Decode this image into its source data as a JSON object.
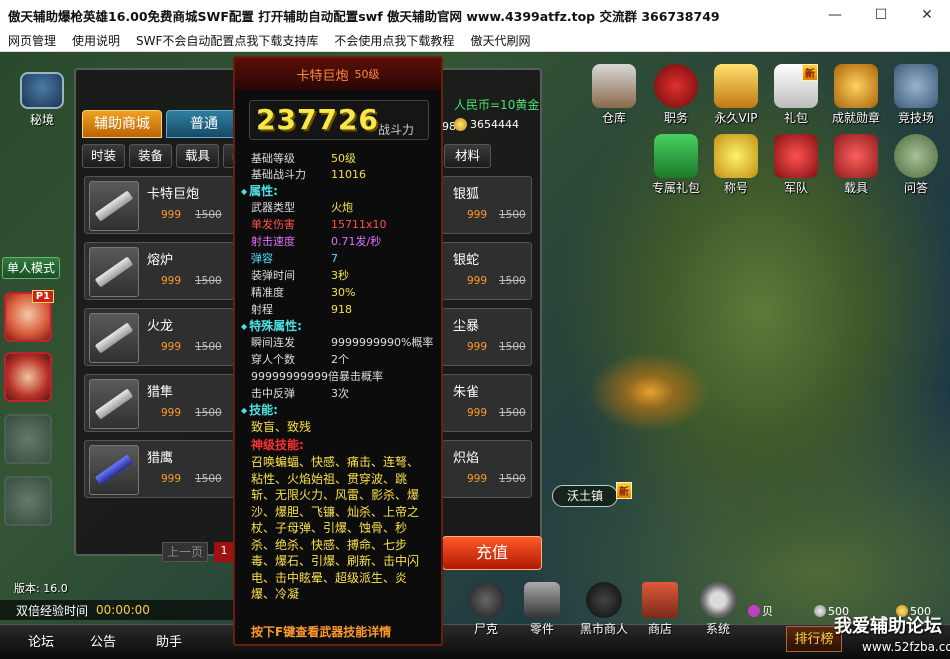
{
  "window": {
    "title": "傲天辅助爆枪英雄16.00免费商城SWF配置  打开辅助自动配置swf 傲天辅助官网 www.4399atfz.top 交流群 366738749",
    "minimize": "—",
    "maximize": "☐",
    "close": "✕"
  },
  "menu": [
    "网页管理",
    "使用说明",
    "SWF不会自动配置点我下载支持库",
    "不会使用点我下载教程",
    "傲天代刷网"
  ],
  "left": {
    "mijing": "秘境",
    "mode": "单人模式",
    "p1": "P1",
    "version": "版本: 16.0",
    "exp_label": "双倍经验时间",
    "exp_time": "00:00:00"
  },
  "bottom": {
    "left_items": [
      "论坛",
      "公告",
      "助手"
    ],
    "icons": [
      {
        "label": "尸克",
        "icon": "zombie-icon"
      },
      {
        "label": "零件",
        "icon": "bullets-icon"
      },
      {
        "label": "黑市商人",
        "icon": "merchant-icon"
      },
      {
        "label": "商店",
        "icon": "shop-icon"
      },
      {
        "label": "系统",
        "icon": "gear-icon"
      }
    ],
    "rank": "排行榜",
    "mini_badge": "贝",
    "silver": "500",
    "gold_small": "500",
    "watermark": "我爱辅助论坛",
    "watermark_url": "www.52fzba.com",
    "partial": "分组"
  },
  "top_icons": [
    {
      "label": "仓库",
      "icon": "warehouse-icon",
      "color": "#c8c8c8"
    },
    {
      "label": "职务",
      "icon": "beret-icon",
      "color": "#c82020"
    },
    {
      "label": "永久VIP",
      "icon": "vip-icon",
      "color": "#e0a020"
    },
    {
      "label": "礼包",
      "icon": "calendar-icon",
      "color": "#e8e8e8",
      "badge": "新"
    },
    {
      "label": "成就勋章",
      "icon": "trophy-icon",
      "color": "#e09a20"
    },
    {
      "label": "竞技场",
      "icon": "crossed-guns-icon",
      "color": "#6a8aa8"
    },
    {
      "label": "专属礼包",
      "icon": "game-gift-icon",
      "color": "#30a840"
    },
    {
      "label": "称号",
      "icon": "crown-icon",
      "color": "#f0c020"
    },
    {
      "label": "军队",
      "icon": "army-icon",
      "color": "#c83030"
    },
    {
      "label": "载具",
      "icon": "vehicle-icon",
      "color": "#d04040"
    },
    {
      "label": "问答",
      "icon": "zombie-head-icon",
      "color": "#80a070"
    }
  ],
  "town": {
    "label": "沃土镇",
    "badge": "新"
  },
  "shop": {
    "tabs": [
      "辅助商城",
      "普通"
    ],
    "rmb": "人民币=10黄金",
    "gold": "3654444",
    "partial_num": "98",
    "categories": [
      "时装",
      "装备",
      "载具",
      "基"
    ],
    "category_right": "材料",
    "items": [
      {
        "name": "卡特巨炮",
        "price": "999",
        "old": "1500"
      },
      {
        "name": "熔炉",
        "price": "999",
        "old": "1500"
      },
      {
        "name": "火龙",
        "price": "999",
        "old": "1500"
      },
      {
        "name": "猎隼",
        "price": "999",
        "old": "1500"
      },
      {
        "name": "猎鹰",
        "price": "999",
        "old": "1500"
      }
    ],
    "right_items": [
      {
        "name": "银狐",
        "price": "999",
        "old": "1500"
      },
      {
        "name": "银蛇",
        "price": "999",
        "old": "1500"
      },
      {
        "name": "尘暴",
        "price": "999",
        "old": "1500"
      },
      {
        "name": "朱雀",
        "price": "999",
        "old": "1500"
      },
      {
        "name": "炽焰",
        "price": "999",
        "old": "1500"
      }
    ],
    "prev": "上一页",
    "page": "1",
    "recharge": "充值"
  },
  "tooltip": {
    "name": "卡特巨炮",
    "level": "50级",
    "power": "237726",
    "power_label": "战斗力",
    "base": [
      {
        "k": "基础等级",
        "v": "50级"
      },
      {
        "k": "基础战斗力",
        "v": "11016"
      }
    ],
    "attr_title": "属性:",
    "attrs": [
      {
        "k": "武器类型",
        "v": "火炮",
        "style": ""
      },
      {
        "k": "单发伤害",
        "v": "15711x10",
        "style": "red"
      },
      {
        "k": "射击速度",
        "v": "0.71发/秒",
        "style": "purple"
      },
      {
        "k": "弹容",
        "v": "7",
        "style": "cyan"
      },
      {
        "k": "装弹时间",
        "v": "3秒",
        "style": ""
      },
      {
        "k": "精准度",
        "v": "30%",
        "style": ""
      },
      {
        "k": "射程",
        "v": "918",
        "style": ""
      }
    ],
    "special_title": "特殊属性:",
    "specials": [
      {
        "k": "瞬间连发",
        "v": "9999999990%概率"
      },
      {
        "k": "穿人个数",
        "v": "2个"
      },
      {
        "k": "99999999999倍",
        "v": "暴击概率"
      },
      {
        "k": "击中反弹",
        "v": "3次"
      }
    ],
    "skill_title": "技能:",
    "skills": "致盲、致残",
    "divine_title": "神级技能:",
    "divine": "召唤蝙蝠、快感、痛击、连弩、粘性、火焰始祖、贯穿波、跳斩、无限火力、风雷、影杀、爆沙、爆胆、飞镰、灿杀、上帝之杖、子母弹、引爆、蚀骨、秒杀、绝杀、快感、搏命、七步毒、爆石、引爆、刷新、击中闪电、击中眩晕、超级派生、炎爆、冷凝",
    "footer": "按下F键查看武器技能详情"
  }
}
